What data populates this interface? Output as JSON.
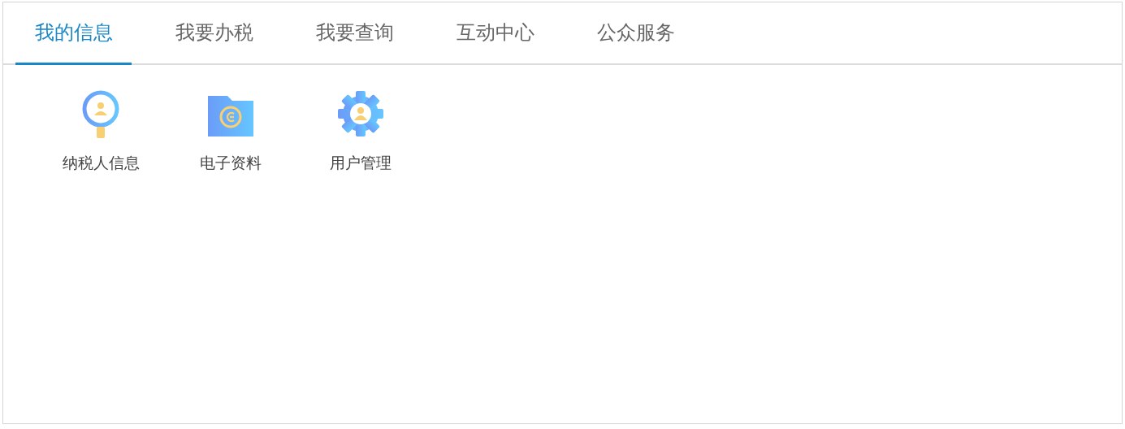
{
  "tabs": [
    {
      "label": "我的信息",
      "selected": true
    },
    {
      "label": "我要办税",
      "selected": false
    },
    {
      "label": "我要查询",
      "selected": false
    },
    {
      "label": "互动中心",
      "selected": false
    },
    {
      "label": "公众服务",
      "selected": false
    }
  ],
  "items": [
    {
      "label": "纳税人信息",
      "kind": "magnifier"
    },
    {
      "label": "电子资料",
      "kind": "folder"
    },
    {
      "label": "用户管理",
      "kind": "gear"
    }
  ]
}
